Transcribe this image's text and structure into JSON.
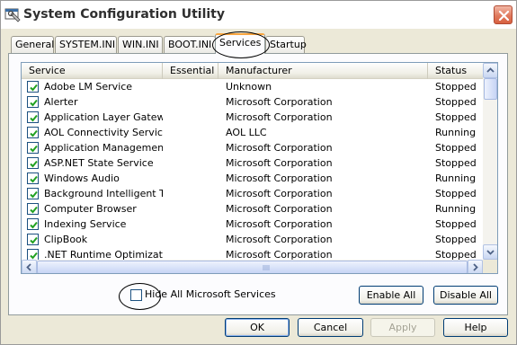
{
  "window": {
    "title": "System Configuration Utility",
    "close_icon": "close-icon"
  },
  "tabs": [
    {
      "label": "General",
      "active": false
    },
    {
      "label": "SYSTEM.INI",
      "active": false
    },
    {
      "label": "WIN.INI",
      "active": false
    },
    {
      "label": "BOOT.INI",
      "active": false
    },
    {
      "label": "Services",
      "active": true
    },
    {
      "label": "Startup",
      "active": false
    }
  ],
  "table": {
    "columns": [
      "Service",
      "Essential",
      "Manufacturer",
      "Status"
    ],
    "rows": [
      {
        "checked": true,
        "service": "Adobe LM Service",
        "essential": "",
        "manufacturer": "Unknown",
        "status": "Stopped"
      },
      {
        "checked": true,
        "service": "Alerter",
        "essential": "",
        "manufacturer": "Microsoft Corporation",
        "status": "Stopped"
      },
      {
        "checked": true,
        "service": "Application Layer Gatew…",
        "essential": "",
        "manufacturer": "Microsoft Corporation",
        "status": "Stopped"
      },
      {
        "checked": true,
        "service": "AOL Connectivity Service",
        "essential": "",
        "manufacturer": "AOL LLC",
        "status": "Running"
      },
      {
        "checked": true,
        "service": "Application Management",
        "essential": "",
        "manufacturer": "Microsoft Corporation",
        "status": "Stopped"
      },
      {
        "checked": true,
        "service": "ASP.NET State Service",
        "essential": "",
        "manufacturer": "Microsoft Corporation",
        "status": "Stopped"
      },
      {
        "checked": true,
        "service": "Windows Audio",
        "essential": "",
        "manufacturer": "Microsoft Corporation",
        "status": "Running"
      },
      {
        "checked": true,
        "service": "Background Intelligent T…",
        "essential": "",
        "manufacturer": "Microsoft Corporation",
        "status": "Stopped"
      },
      {
        "checked": true,
        "service": "Computer Browser",
        "essential": "",
        "manufacturer": "Microsoft Corporation",
        "status": "Running"
      },
      {
        "checked": true,
        "service": "Indexing Service",
        "essential": "",
        "manufacturer": "Microsoft Corporation",
        "status": "Stopped"
      },
      {
        "checked": true,
        "service": "ClipBook",
        "essential": "",
        "manufacturer": "Microsoft Corporation",
        "status": "Stopped"
      },
      {
        "checked": true,
        "service": ".NET Runtime Optimizati…",
        "essential": "",
        "manufacturer": "Microsoft Corporation",
        "status": "Stopped"
      }
    ]
  },
  "hide_ms": {
    "label": "Hide All Microsoft Services",
    "checked": false
  },
  "buttons": {
    "enable_all": "Enable All",
    "disable_all": "Disable All",
    "ok": "OK",
    "cancel": "Cancel",
    "apply": "Apply",
    "help": "Help"
  },
  "colors": {
    "titlebar_bg": "#ffffff",
    "window_bg": "#ece9d8",
    "check_green": "#21a121",
    "active_tab_accent": "#f9a640",
    "close_button": "#d8603f"
  }
}
